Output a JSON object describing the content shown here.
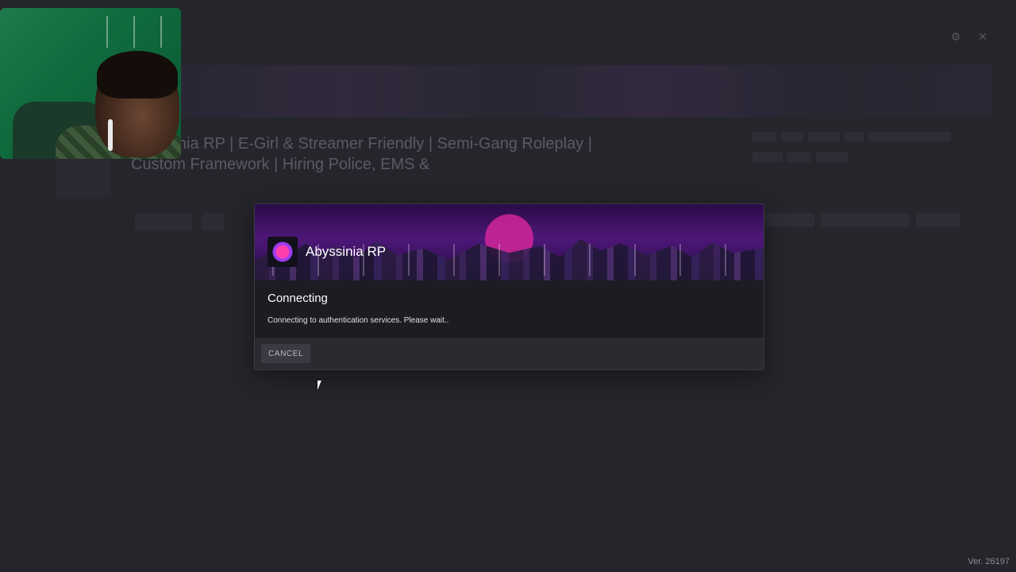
{
  "background": {
    "title_line1": "Abyssinia RP | E-Girl & Streamer Friendly | Semi-Gang Roleplay |",
    "title_line2": "Custom Framework | Hiring Police, EMS &"
  },
  "dialog": {
    "server_name": "Abyssinia RP",
    "heading": "Connecting",
    "message": "Connecting to authentication services. Please wait..",
    "cancel_label": "CANCEL"
  },
  "footer": {
    "version": "Ver. 26197"
  },
  "colors": {
    "accent_purple": "#4d1778",
    "dialog_bg": "#1c1c22",
    "page_bg": "#25252c"
  }
}
